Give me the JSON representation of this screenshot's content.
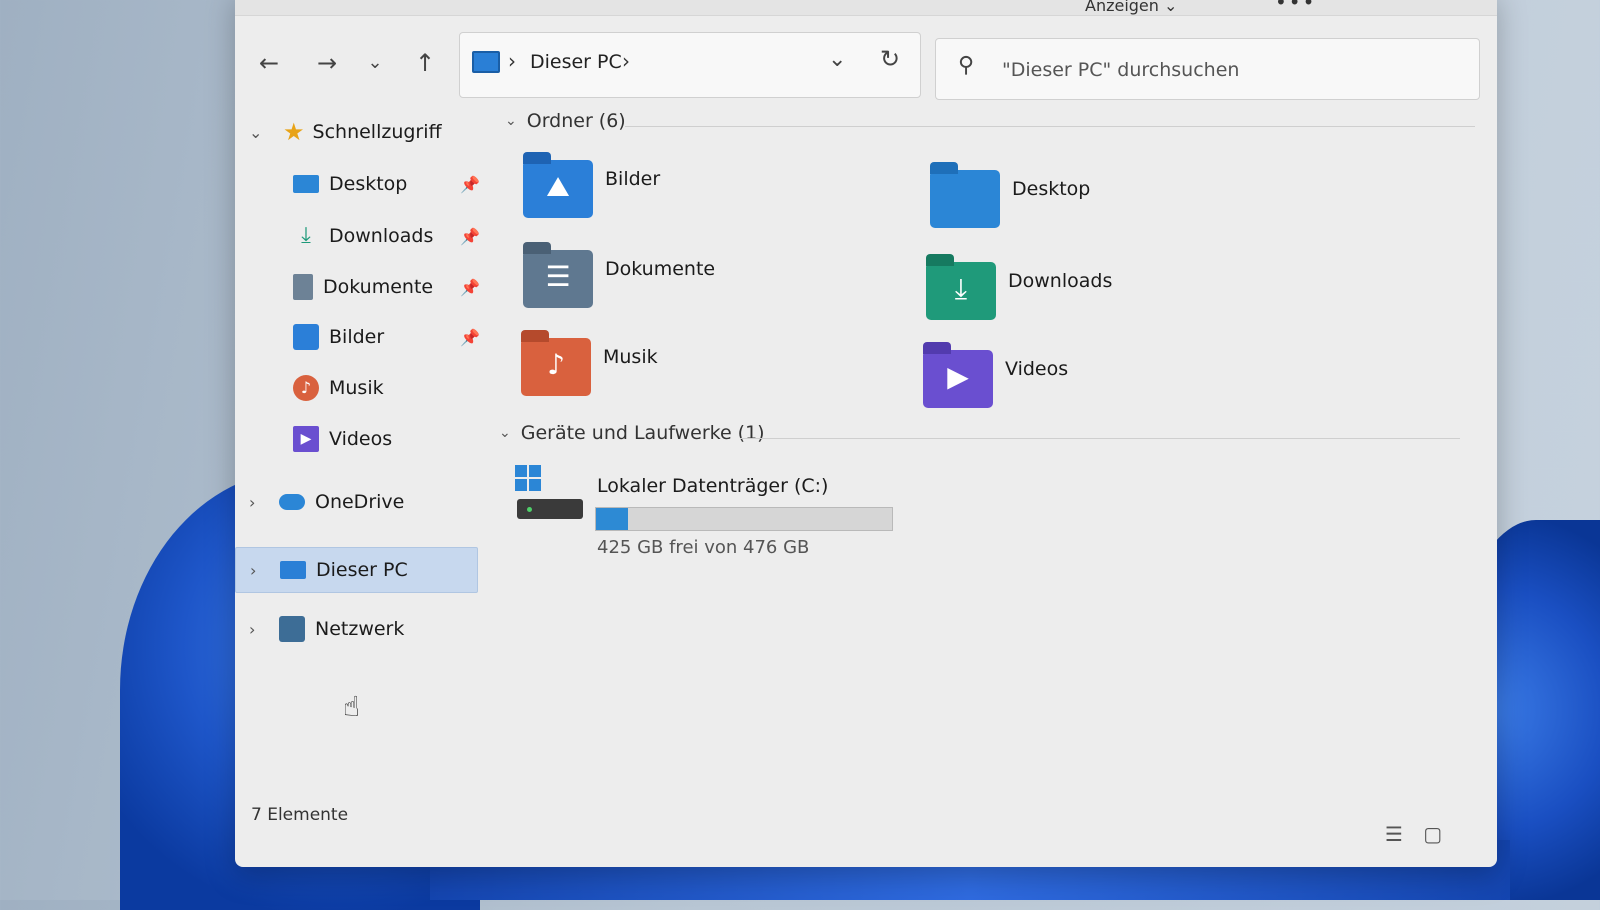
{
  "commandbar": {
    "view_label": "Anzeigen",
    "more_label": "•••"
  },
  "address": {
    "breadcrumb": "Dieser PC",
    "separator": "›"
  },
  "search": {
    "placeholder": "\"Dieser PC\" durchsuchen"
  },
  "sidebar": {
    "quick_access": "Schnellzugriff",
    "items": [
      {
        "label": "Desktop",
        "pinned": true
      },
      {
        "label": "Downloads",
        "pinned": true
      },
      {
        "label": "Dokumente",
        "pinned": true
      },
      {
        "label": "Bilder",
        "pinned": true
      },
      {
        "label": "Musik",
        "pinned": false
      },
      {
        "label": "Videos",
        "pinned": false
      }
    ],
    "onedrive": "OneDrive",
    "this_pc": "Dieser PC",
    "network": "Netzwerk"
  },
  "content": {
    "folders_header": "Ordner (6)",
    "folders": [
      {
        "label": "Bilder",
        "color": "#2b7fd8"
      },
      {
        "label": "Desktop",
        "color": "#2b86d6"
      },
      {
        "label": "Dokumente",
        "color": "#5f7890"
      },
      {
        "label": "Downloads",
        "color": "#1f9a7a"
      },
      {
        "label": "Musik",
        "color": "#d9613e"
      },
      {
        "label": "Videos",
        "color": "#6a4fd0"
      }
    ],
    "drives_header": "Geräte und Laufwerke (1)",
    "drive": {
      "label": "Lokaler Datenträger (C:)",
      "free_text": "425 GB frei von 476 GB",
      "used_fraction": 0.107
    }
  },
  "status": {
    "count": "7 Elemente"
  },
  "icons": {
    "back": "←",
    "forward": "→",
    "recent": "⌄",
    "up": "↑",
    "refresh": "↻",
    "dropdown": "⌄",
    "search": "⚲",
    "pin": "📌",
    "chevron_down": "⌄",
    "chevron_right": "›",
    "star": "★",
    "list_view": "☰",
    "tile_view": "▢"
  }
}
